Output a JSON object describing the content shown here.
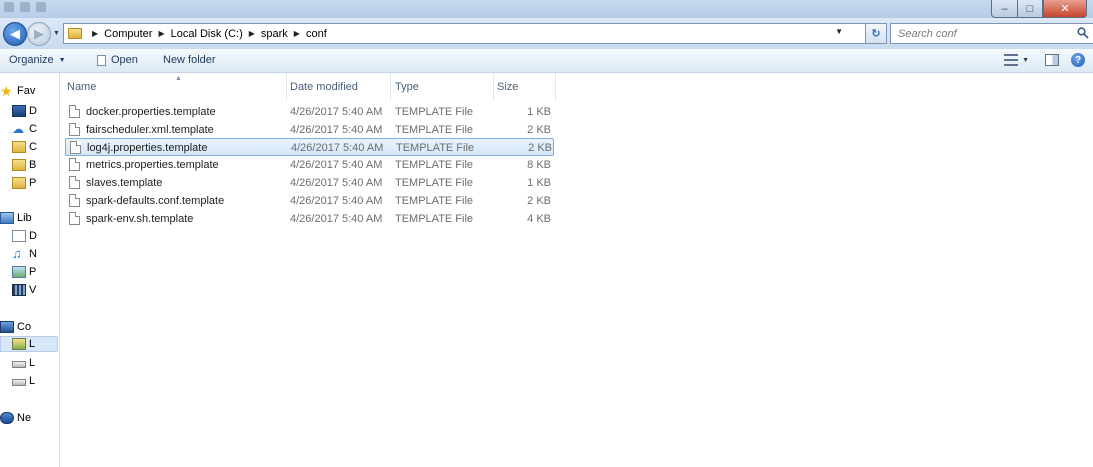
{
  "window": {
    "title": ""
  },
  "address": {
    "crumbs": [
      "Computer",
      "Local Disk (C:)",
      "spark",
      "conf"
    ]
  },
  "search": {
    "placeholder": "Search conf"
  },
  "toolbar": {
    "organize_label": "Organize",
    "open_label": "Open",
    "new_folder_label": "New folder"
  },
  "sidebar": {
    "items": [
      {
        "label": "Fav",
        "icon": "star-icon"
      },
      {
        "label": "D",
        "icon": "desktop-icon"
      },
      {
        "label": "C",
        "icon": "cloud-icon"
      },
      {
        "label": "C",
        "icon": "folder-icon"
      },
      {
        "label": "B",
        "icon": "folder-icon"
      },
      {
        "label": "P",
        "icon": "folder-icon"
      },
      {
        "label": "Lib",
        "icon": "libraries-icon"
      },
      {
        "label": "D",
        "icon": "documents-icon"
      },
      {
        "label": "N",
        "icon": "music-icon"
      },
      {
        "label": "P",
        "icon": "pictures-icon"
      },
      {
        "label": "V",
        "icon": "videos-icon"
      },
      {
        "label": "Co",
        "icon": "computer-icon"
      },
      {
        "label": "L",
        "icon": "drive-icon"
      },
      {
        "label": "L",
        "icon": "drive-icon"
      },
      {
        "label": "L",
        "icon": "drive-icon"
      },
      {
        "label": "Ne",
        "icon": "network-icon"
      }
    ]
  },
  "columns": {
    "name": "Name",
    "date": "Date modified",
    "type": "Type",
    "size": "Size"
  },
  "files": [
    {
      "name": "docker.properties.template",
      "date": "4/26/2017 5:40 AM",
      "type": "TEMPLATE File",
      "size": "1 KB",
      "selected": false
    },
    {
      "name": "fairscheduler.xml.template",
      "date": "4/26/2017 5:40 AM",
      "type": "TEMPLATE File",
      "size": "2 KB",
      "selected": false
    },
    {
      "name": "log4j.properties.template",
      "date": "4/26/2017 5:40 AM",
      "type": "TEMPLATE File",
      "size": "2 KB",
      "selected": true
    },
    {
      "name": "metrics.properties.template",
      "date": "4/26/2017 5:40 AM",
      "type": "TEMPLATE File",
      "size": "8 KB",
      "selected": false
    },
    {
      "name": "slaves.template",
      "date": "4/26/2017 5:40 AM",
      "type": "TEMPLATE File",
      "size": "1 KB",
      "selected": false
    },
    {
      "name": "spark-defaults.conf.template",
      "date": "4/26/2017 5:40 AM",
      "type": "TEMPLATE File",
      "size": "2 KB",
      "selected": false
    },
    {
      "name": "spark-env.sh.template",
      "date": "4/26/2017 5:40 AM",
      "type": "TEMPLATE File",
      "size": "4 KB",
      "selected": false
    }
  ],
  "colors": {
    "selection": "#d5e7fb",
    "selection_border": "#84acdd",
    "chrome": "#c9dbef"
  }
}
